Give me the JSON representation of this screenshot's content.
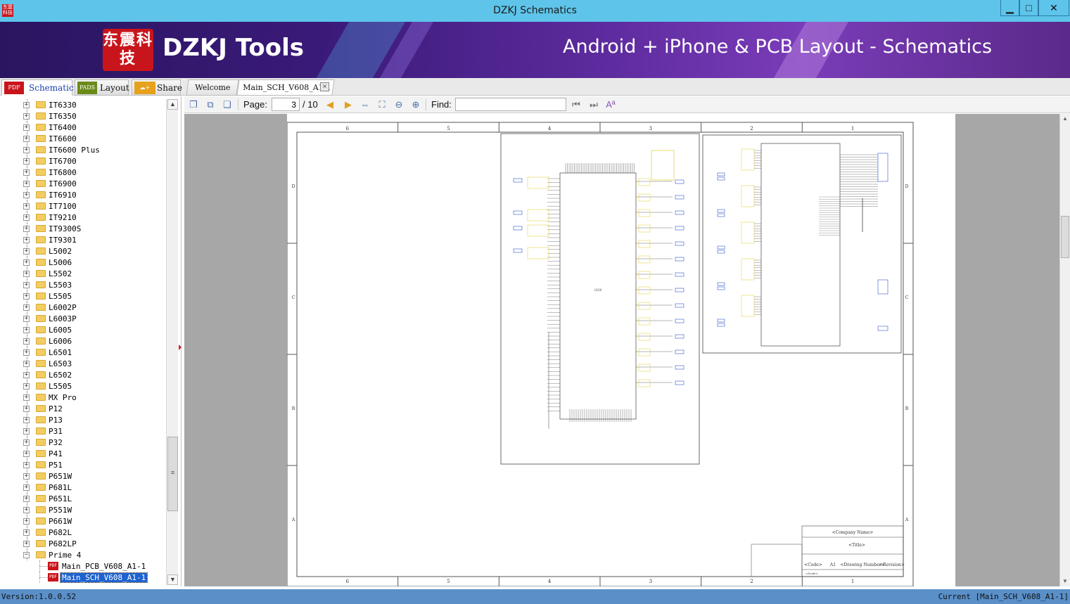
{
  "window": {
    "title": "DZKJ Schematics",
    "app_icon_text": "东震科技",
    "minimize_glyph": "▁",
    "maximize_glyph": "□",
    "close_glyph": "✕"
  },
  "banner": {
    "logo_text": "东震科技",
    "brand": "DZKJ Tools",
    "tagline": "Android + iPhone & PCB Layout - Schematics"
  },
  "mode_tabs": {
    "schematic": {
      "icon_text": "PDF",
      "label": "Schematic"
    },
    "layout": {
      "icon_text": "PADS",
      "label": "Layout"
    },
    "share": {
      "icon_text": "☁+",
      "label": "Share"
    }
  },
  "doc_tabs": {
    "welcome": "Welcome",
    "main": "Main_SCH_V608_A1-1",
    "close_glyph": "×"
  },
  "tree": {
    "items": [
      "IT6330",
      "IT6350",
      "IT6400",
      "IT6600",
      "IT6600 Plus",
      "IT6700",
      "IT6800",
      "IT6900",
      "IT6910",
      "IT7100",
      "IT9210",
      "IT9300S",
      "IT9301",
      "L5002",
      "L5006",
      "L5502",
      "L5503",
      "L5505",
      "L6002P",
      "L6003P",
      "L6005",
      "L6006",
      "L6501",
      "L6503",
      "L6502",
      "L5505",
      "MX Pro",
      "P12",
      "P13",
      "P31",
      "P32",
      "P41",
      "P51",
      "P651W",
      "P681L",
      "P651L",
      "P551W",
      "P661W",
      "P682L",
      "P682LP",
      "Prime 4"
    ],
    "expanded_item": "Prime 4",
    "children": [
      {
        "icon_text": "PDF",
        "label": "Main_PCB_V608_A1-1",
        "selected": false
      },
      {
        "icon_text": "PDF",
        "label": "Main_SCH_V608_A1-1",
        "selected": true
      }
    ],
    "expander_collapsed": "+",
    "expander_expanded": "−"
  },
  "tree_scrollbar": {
    "up_glyph": "▲",
    "down_glyph": "▼",
    "thumb_glyph": "≡"
  },
  "toolbar": {
    "page_label": "Page:",
    "page_value": "3",
    "page_total": "/ 10",
    "find_label": "Find:",
    "find_value": "",
    "icons": [
      "copy-icon",
      "copy-all-icon",
      "paste-icon",
      "prev-page-icon",
      "next-page-icon",
      "fit-width-icon",
      "fit-page-icon",
      "zoom-out-icon",
      "zoom-in-icon",
      "find-first-icon",
      "find-next-icon",
      "match-case-icon"
    ]
  },
  "schematic": {
    "column_labels": [
      "6",
      "5",
      "4",
      "3",
      "2",
      "1"
    ],
    "row_labels": [
      "D",
      "C",
      "B",
      "A"
    ],
    "title_block": {
      "company": "<Company Name>",
      "title": "<Title>",
      "code": "<Code>",
      "size": "A1",
      "drawing_number": "<Drawing Number>",
      "revision": "<Revision>",
      "scale": "<Scale>"
    },
    "main_block_label": "U100",
    "colors": {
      "border": "#555555",
      "wire": "#3355cc",
      "pin_box": "#e6d24a",
      "body": "#444444"
    }
  },
  "statusbar": {
    "version": "Version:1.0.0.52",
    "current": "Current [Main_SCH_V608_A1-1]"
  }
}
